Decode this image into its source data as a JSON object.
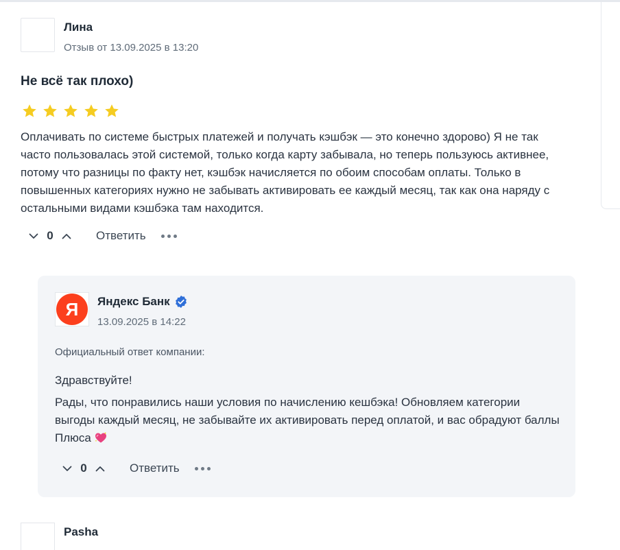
{
  "review": {
    "author": "Лина",
    "date": "Отзыв от 13.09.2025 в 13:20",
    "title": "Не всё так плохо)",
    "rating": 5,
    "text": "Оплачивать по системе быстрых платежей и получать кэшбэк — это конечно здорово) Я не так часто пользовалась этой системой, только когда карту забывала, но теперь пользуюсь активнее, потому что разницы по факту нет, кэшбэк начисляется по обоим способам оплаты. Только в повышенных категориях нужно не забывать активировать ее каждый месяц, так как она наряду с остальными видами кэшбэка там находится.",
    "votes": "0",
    "reply_label": "Ответить"
  },
  "company_reply": {
    "logo_letter": "Я",
    "name": "Яндекс Банк",
    "date": "13.09.2025 в 14:22",
    "official_label": "Официальный ответ компании:",
    "greeting": "Здравствуйте!",
    "text": "Рады, что понравились наши условия по начислению кешбэка! Обновляем категории выгоды каждый месяц, не забывайте их активировать перед оплатой, и вас обрадуют баллы Плюса",
    "votes": "0",
    "reply_label": "Ответить"
  },
  "next_review": {
    "author": "Pasha"
  },
  "icons": {
    "star": "star-icon",
    "verified": "verified-check-icon",
    "heart": "sparkling-heart-icon",
    "vote_down": "chevron-down-icon",
    "vote_up": "chevron-up-icon",
    "more": "more-dots-icon"
  },
  "colors": {
    "star": "#f5cc21",
    "logo_bg": "#fc3f1d",
    "verified": "#2f6fd8",
    "reply_bg": "#f3f5f8"
  }
}
